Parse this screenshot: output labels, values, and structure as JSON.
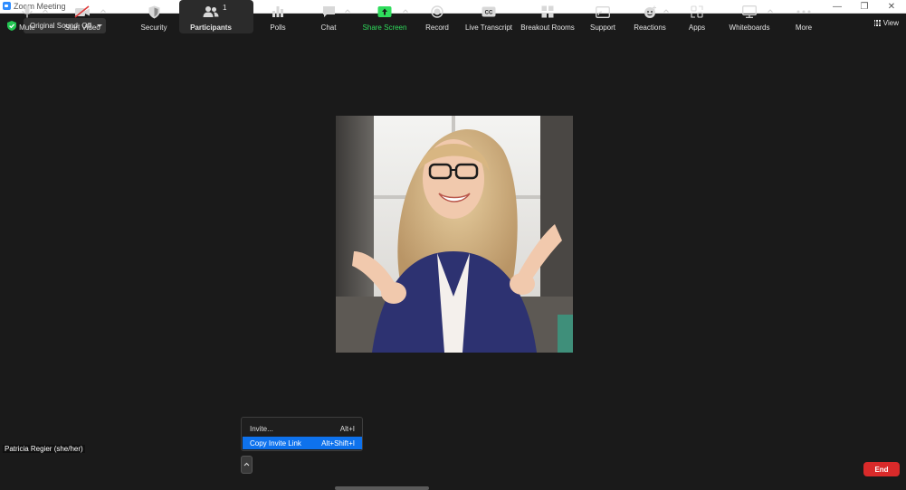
{
  "window": {
    "title": "Zoom Meeting",
    "minimize_glyph": "—",
    "restore_glyph": "❐",
    "close_glyph": "✕"
  },
  "top_bar": {
    "original_sound": "Original Sound: Off",
    "view_label": "View"
  },
  "participant": {
    "name": "Patricia Regier (she/her)"
  },
  "invite_menu": {
    "items": [
      {
        "label": "Invite...",
        "shortcut": "Alt+I"
      },
      {
        "label": "Copy Invite Link",
        "shortcut": "Alt+Shift+I"
      }
    ]
  },
  "toolbar": {
    "mute": "Mute",
    "start_video": "Start Video",
    "security": "Security",
    "participants": "Participants",
    "participants_count": "1",
    "polls": "Polls",
    "chat": "Chat",
    "share_screen": "Share Screen",
    "record": "Record",
    "live_transcript": "Live Transcript",
    "breakout_rooms": "Breakout Rooms",
    "support": "Support",
    "reactions": "Reactions",
    "apps": "Apps",
    "whiteboards": "Whiteboards",
    "more": "More",
    "end": "End"
  },
  "colors": {
    "background": "#1a1a1a",
    "accent_blue": "#0e72ed",
    "share_green": "#2fdc5c",
    "end_red": "#d92a2a",
    "shield_green": "#23c552"
  }
}
